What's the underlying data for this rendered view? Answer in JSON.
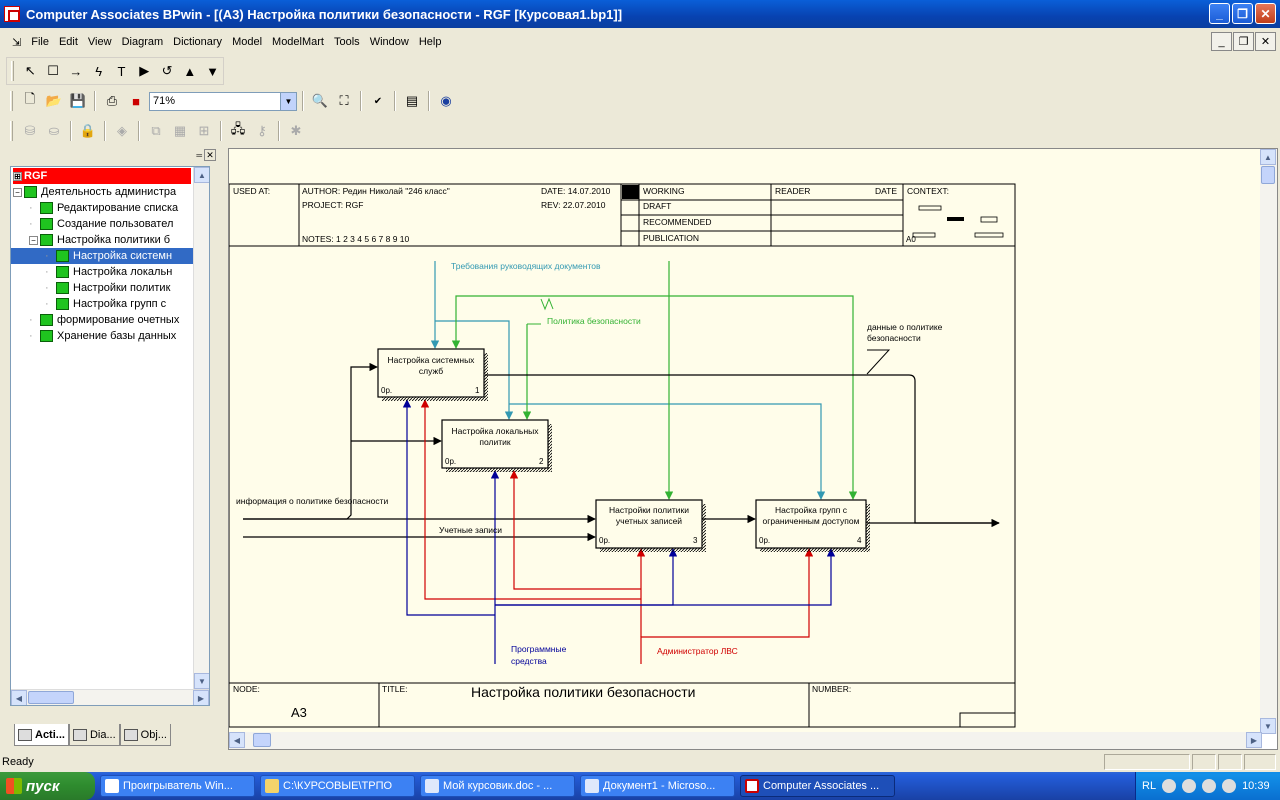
{
  "window": {
    "title": "Computer Associates BPwin - [(A3) Настройка политики  безопасности - RGF  [Курсовая1.bp1]]"
  },
  "menu": [
    "File",
    "Edit",
    "View",
    "Diagram",
    "Dictionary",
    "Model",
    "ModelMart",
    "Tools",
    "Window",
    "Help"
  ],
  "toolbar": {
    "zoom": "71%"
  },
  "tree": {
    "root": "RGF",
    "items": [
      {
        "label": "Деятельность администра",
        "level": 1,
        "expander": "−"
      },
      {
        "label": "Редактирование списка",
        "level": 2
      },
      {
        "label": "Создание пользовател",
        "level": 2
      },
      {
        "label": "Настройка политики  б",
        "level": 2,
        "expander": "−"
      },
      {
        "label": "Настройка системн",
        "level": 3,
        "selected": true
      },
      {
        "label": "Настройка локальн",
        "level": 3
      },
      {
        "label": "Настройки политик",
        "level": 3
      },
      {
        "label": "Настройка групп с",
        "level": 3
      },
      {
        "label": "формирование очетных",
        "level": 2
      },
      {
        "label": "Хранение  базы данных",
        "level": 2
      }
    ]
  },
  "tabs": [
    "Acti...",
    "Dia...",
    "Obj..."
  ],
  "header": {
    "used_at": "USED AT:",
    "author": "AUTHOR:  Редин Николай \"246 класс\"",
    "date": "DATE:  14.07.2010",
    "project": "PROJECT:  RGF",
    "rev": "REV:    22.07.2010",
    "notes": "NOTES:  1  2  3  4  5  6  7  8  9  10",
    "working": "WORKING",
    "draft": "DRAFT",
    "recommended": "RECOMMENDED",
    "publication": "PUBLICATION",
    "reader": "READER",
    "reader_date": "DATE",
    "context": "CONTEXT:",
    "context_node": "A0"
  },
  "footer": {
    "node_label": "NODE:",
    "node": "A3",
    "title_label": "TITLE:",
    "title": "Настройка политики  безопасности",
    "number_label": "NUMBER:"
  },
  "boxes": [
    {
      "label": "Настройка системных служб",
      "cost": "0р.",
      "num": "1"
    },
    {
      "label": "Настройка локальных политик",
      "cost": "0р.",
      "num": "2"
    },
    {
      "label": "Настройки политики учетных записей",
      "cost": "0р.",
      "num": "3"
    },
    {
      "label": "Настройка групп с ограниченным доступом",
      "cost": "0р.",
      "num": "4"
    }
  ],
  "arrow_labels": {
    "req_docs": "Требования руководящих документов",
    "security_policy": "Политика безопасности",
    "policy_data_1": "данные о политике",
    "policy_data_2": "безопасности",
    "policy_info": "информация о политике безопасности",
    "accounts": "Учетные записи",
    "software_1": "Программные",
    "software_2": "средства",
    "admin": "Администратор ЛВС"
  },
  "status": {
    "text": "Ready"
  },
  "taskbar": {
    "start": "пуск",
    "tasks": [
      {
        "label": "Проигрыватель Win...",
        "active": false
      },
      {
        "label": "C:\\КУРСОВЫЕ\\ТРПО",
        "active": false
      },
      {
        "label": "Мой курсовик.doc - ...",
        "active": false
      },
      {
        "label": "Документ1 - Microso...",
        "active": false
      },
      {
        "label": "Computer Associates ...",
        "active": true
      }
    ],
    "lang": "RL",
    "clock": "10:39"
  },
  "colors": {
    "control": "#c00000",
    "input": "#000000",
    "mechanism_red": "#d00000",
    "mechanism_blue": "#000099",
    "green": "#33b233",
    "teal": "#3399b2"
  }
}
